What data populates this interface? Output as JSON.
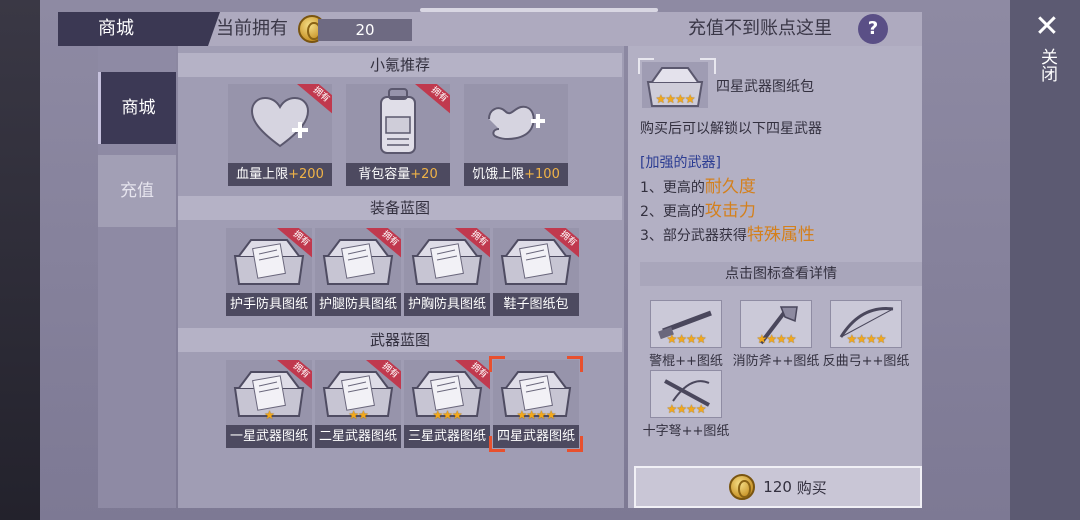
{
  "header": {
    "shop_title": "商城",
    "owned_label": "当前拥有",
    "coin_amount": "20",
    "help_text": "充值不到账点这里",
    "help_icon": "?"
  },
  "sidebar": {
    "tabs": [
      "商城",
      "充值"
    ]
  },
  "sections": {
    "recommend": {
      "title": "小氪推荐",
      "items": [
        {
          "name": "血量上限",
          "bonus": "+200",
          "badge": "拥有"
        },
        {
          "name": "背包容量",
          "bonus": "+20",
          "badge": "拥有"
        },
        {
          "name": "饥饿上限",
          "bonus": "+100",
          "badge": ""
        }
      ]
    },
    "equipment": {
      "title": "装备蓝图",
      "items": [
        {
          "name": "护手防具图纸",
          "badge": "拥有"
        },
        {
          "name": "护腿防具图纸",
          "badge": "拥有"
        },
        {
          "name": "护胸防具图纸",
          "badge": "拥有"
        },
        {
          "name": "鞋子图纸包",
          "badge": "拥有"
        }
      ]
    },
    "weapons": {
      "title": "武器蓝图",
      "items": [
        {
          "name": "一星武器图纸",
          "badge": "拥有",
          "stars": 1
        },
        {
          "name": "二星武器图纸",
          "badge": "拥有",
          "stars": 2
        },
        {
          "name": "三星武器图纸",
          "badge": "拥有",
          "stars": 3
        },
        {
          "name": "四星武器图纸",
          "badge": "",
          "stars": 4,
          "selected": true
        }
      ]
    }
  },
  "detail": {
    "title": "四星武器图纸包",
    "desc": "购买后可以解锁以下四星武器",
    "sub_header": "[加强的武器]",
    "bullets": [
      {
        "prefix": "1、更高的",
        "highlight": "耐久度"
      },
      {
        "prefix": "2、更高的",
        "highlight": "攻击力"
      },
      {
        "prefix": "3、部分武器获得",
        "highlight": "特殊属性"
      }
    ],
    "view_header": "点击图标查看详情",
    "weapons": [
      "警棍++图纸",
      "消防斧++图纸",
      "反曲弓++图纸",
      "十字弩++图纸"
    ],
    "buy_price": "120",
    "buy_label": "购买"
  },
  "close": {
    "icon": "✕",
    "label": "关闭"
  },
  "colors": {
    "accent": "#3c3955",
    "badge": "#c0394e",
    "star": "#f2a81c",
    "highlight": "#d4801c",
    "select": "#e8502e"
  }
}
